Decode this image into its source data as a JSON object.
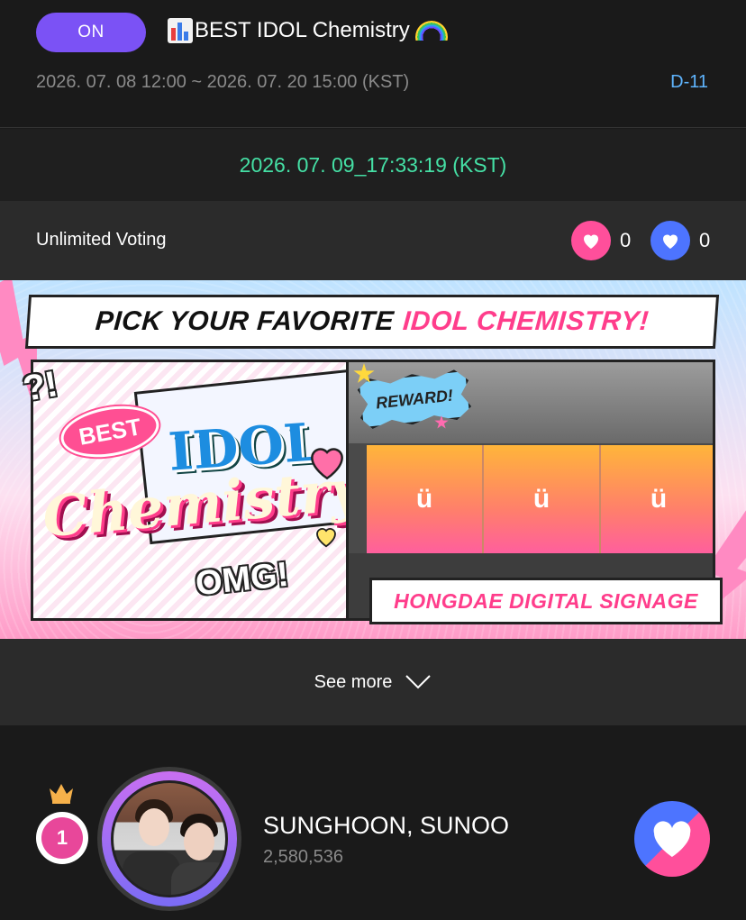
{
  "header": {
    "status_badge": "ON",
    "title": "BEST IDOL Chemistry",
    "title_icon": "bar-chart-emoji",
    "title_trailing_icon": "rainbow-emoji",
    "period": "2026. 07. 08 12:00 ~ 2026. 07. 20 15:00 (KST)",
    "dday": "D-11"
  },
  "clock": {
    "current_time": "2026. 07. 09_17:33:19 (KST)"
  },
  "voting": {
    "label": "Unlimited Voting",
    "pink_heart_count": "0",
    "blue_heart_count": "0"
  },
  "banner": {
    "headline_dark": "PICK YOUR FAVORITE",
    "headline_pink": "IDOL CHEMISTRY!",
    "question": "?!",
    "best": "BEST",
    "idol": "IDOL",
    "chemistry": "Chemistry",
    "omg": "OMG!",
    "reward": "REWARD!",
    "signage": "HONGDAE DIGITAL SIGNAGE",
    "screen_logo": "ü"
  },
  "see_more": {
    "label": "See more"
  },
  "ranking": [
    {
      "rank": "1",
      "name": "SUNGHOON, SUNOO",
      "votes": "2,580,536"
    }
  ],
  "colors": {
    "on_badge": "#7b52f5",
    "dday": "#5fb5ff",
    "clock": "#45e0a5",
    "pink_heart": "#ff4f9b",
    "blue_heart": "#4d74ff",
    "rank_badge": "#e8479a"
  }
}
